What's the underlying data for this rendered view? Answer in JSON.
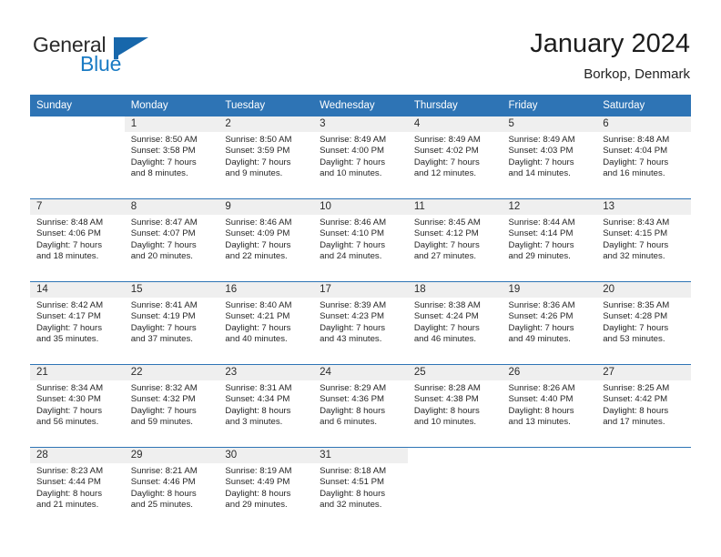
{
  "brand": {
    "name_part1": "General",
    "name_part2": "Blue",
    "flag_icon": "flag-triangle-icon",
    "accent_color": "#1767ab"
  },
  "header": {
    "title": "January 2024",
    "location": "Borkop, Denmark"
  },
  "theme": {
    "header_blue": "#2e74b5",
    "daynum_band": "#efefef",
    "text": "#262626"
  },
  "weekday_headers": [
    "Sunday",
    "Monday",
    "Tuesday",
    "Wednesday",
    "Thursday",
    "Friday",
    "Saturday"
  ],
  "weeks": [
    [
      {
        "day": "",
        "sunrise": "",
        "sunset": "",
        "daylight_line1": "",
        "daylight_line2": "",
        "blank": true
      },
      {
        "day": "1",
        "sunrise": "Sunrise: 8:50 AM",
        "sunset": "Sunset: 3:58 PM",
        "daylight_line1": "Daylight: 7 hours",
        "daylight_line2": "and 8 minutes."
      },
      {
        "day": "2",
        "sunrise": "Sunrise: 8:50 AM",
        "sunset": "Sunset: 3:59 PM",
        "daylight_line1": "Daylight: 7 hours",
        "daylight_line2": "and 9 minutes."
      },
      {
        "day": "3",
        "sunrise": "Sunrise: 8:49 AM",
        "sunset": "Sunset: 4:00 PM",
        "daylight_line1": "Daylight: 7 hours",
        "daylight_line2": "and 10 minutes."
      },
      {
        "day": "4",
        "sunrise": "Sunrise: 8:49 AM",
        "sunset": "Sunset: 4:02 PM",
        "daylight_line1": "Daylight: 7 hours",
        "daylight_line2": "and 12 minutes."
      },
      {
        "day": "5",
        "sunrise": "Sunrise: 8:49 AM",
        "sunset": "Sunset: 4:03 PM",
        "daylight_line1": "Daylight: 7 hours",
        "daylight_line2": "and 14 minutes."
      },
      {
        "day": "6",
        "sunrise": "Sunrise: 8:48 AM",
        "sunset": "Sunset: 4:04 PM",
        "daylight_line1": "Daylight: 7 hours",
        "daylight_line2": "and 16 minutes."
      }
    ],
    [
      {
        "day": "7",
        "sunrise": "Sunrise: 8:48 AM",
        "sunset": "Sunset: 4:06 PM",
        "daylight_line1": "Daylight: 7 hours",
        "daylight_line2": "and 18 minutes."
      },
      {
        "day": "8",
        "sunrise": "Sunrise: 8:47 AM",
        "sunset": "Sunset: 4:07 PM",
        "daylight_line1": "Daylight: 7 hours",
        "daylight_line2": "and 20 minutes."
      },
      {
        "day": "9",
        "sunrise": "Sunrise: 8:46 AM",
        "sunset": "Sunset: 4:09 PM",
        "daylight_line1": "Daylight: 7 hours",
        "daylight_line2": "and 22 minutes."
      },
      {
        "day": "10",
        "sunrise": "Sunrise: 8:46 AM",
        "sunset": "Sunset: 4:10 PM",
        "daylight_line1": "Daylight: 7 hours",
        "daylight_line2": "and 24 minutes."
      },
      {
        "day": "11",
        "sunrise": "Sunrise: 8:45 AM",
        "sunset": "Sunset: 4:12 PM",
        "daylight_line1": "Daylight: 7 hours",
        "daylight_line2": "and 27 minutes."
      },
      {
        "day": "12",
        "sunrise": "Sunrise: 8:44 AM",
        "sunset": "Sunset: 4:14 PM",
        "daylight_line1": "Daylight: 7 hours",
        "daylight_line2": "and 29 minutes."
      },
      {
        "day": "13",
        "sunrise": "Sunrise: 8:43 AM",
        "sunset": "Sunset: 4:15 PM",
        "daylight_line1": "Daylight: 7 hours",
        "daylight_line2": "and 32 minutes."
      }
    ],
    [
      {
        "day": "14",
        "sunrise": "Sunrise: 8:42 AM",
        "sunset": "Sunset: 4:17 PM",
        "daylight_line1": "Daylight: 7 hours",
        "daylight_line2": "and 35 minutes."
      },
      {
        "day": "15",
        "sunrise": "Sunrise: 8:41 AM",
        "sunset": "Sunset: 4:19 PM",
        "daylight_line1": "Daylight: 7 hours",
        "daylight_line2": "and 37 minutes."
      },
      {
        "day": "16",
        "sunrise": "Sunrise: 8:40 AM",
        "sunset": "Sunset: 4:21 PM",
        "daylight_line1": "Daylight: 7 hours",
        "daylight_line2": "and 40 minutes."
      },
      {
        "day": "17",
        "sunrise": "Sunrise: 8:39 AM",
        "sunset": "Sunset: 4:23 PM",
        "daylight_line1": "Daylight: 7 hours",
        "daylight_line2": "and 43 minutes."
      },
      {
        "day": "18",
        "sunrise": "Sunrise: 8:38 AM",
        "sunset": "Sunset: 4:24 PM",
        "daylight_line1": "Daylight: 7 hours",
        "daylight_line2": "and 46 minutes."
      },
      {
        "day": "19",
        "sunrise": "Sunrise: 8:36 AM",
        "sunset": "Sunset: 4:26 PM",
        "daylight_line1": "Daylight: 7 hours",
        "daylight_line2": "and 49 minutes."
      },
      {
        "day": "20",
        "sunrise": "Sunrise: 8:35 AM",
        "sunset": "Sunset: 4:28 PM",
        "daylight_line1": "Daylight: 7 hours",
        "daylight_line2": "and 53 minutes."
      }
    ],
    [
      {
        "day": "21",
        "sunrise": "Sunrise: 8:34 AM",
        "sunset": "Sunset: 4:30 PM",
        "daylight_line1": "Daylight: 7 hours",
        "daylight_line2": "and 56 minutes."
      },
      {
        "day": "22",
        "sunrise": "Sunrise: 8:32 AM",
        "sunset": "Sunset: 4:32 PM",
        "daylight_line1": "Daylight: 7 hours",
        "daylight_line2": "and 59 minutes."
      },
      {
        "day": "23",
        "sunrise": "Sunrise: 8:31 AM",
        "sunset": "Sunset: 4:34 PM",
        "daylight_line1": "Daylight: 8 hours",
        "daylight_line2": "and 3 minutes."
      },
      {
        "day": "24",
        "sunrise": "Sunrise: 8:29 AM",
        "sunset": "Sunset: 4:36 PM",
        "daylight_line1": "Daylight: 8 hours",
        "daylight_line2": "and 6 minutes."
      },
      {
        "day": "25",
        "sunrise": "Sunrise: 8:28 AM",
        "sunset": "Sunset: 4:38 PM",
        "daylight_line1": "Daylight: 8 hours",
        "daylight_line2": "and 10 minutes."
      },
      {
        "day": "26",
        "sunrise": "Sunrise: 8:26 AM",
        "sunset": "Sunset: 4:40 PM",
        "daylight_line1": "Daylight: 8 hours",
        "daylight_line2": "and 13 minutes."
      },
      {
        "day": "27",
        "sunrise": "Sunrise: 8:25 AM",
        "sunset": "Sunset: 4:42 PM",
        "daylight_line1": "Daylight: 8 hours",
        "daylight_line2": "and 17 minutes."
      }
    ],
    [
      {
        "day": "28",
        "sunrise": "Sunrise: 8:23 AM",
        "sunset": "Sunset: 4:44 PM",
        "daylight_line1": "Daylight: 8 hours",
        "daylight_line2": "and 21 minutes."
      },
      {
        "day": "29",
        "sunrise": "Sunrise: 8:21 AM",
        "sunset": "Sunset: 4:46 PM",
        "daylight_line1": "Daylight: 8 hours",
        "daylight_line2": "and 25 minutes."
      },
      {
        "day": "30",
        "sunrise": "Sunrise: 8:19 AM",
        "sunset": "Sunset: 4:49 PM",
        "daylight_line1": "Daylight: 8 hours",
        "daylight_line2": "and 29 minutes."
      },
      {
        "day": "31",
        "sunrise": "Sunrise: 8:18 AM",
        "sunset": "Sunset: 4:51 PM",
        "daylight_line1": "Daylight: 8 hours",
        "daylight_line2": "and 32 minutes."
      },
      {
        "day": "",
        "sunrise": "",
        "sunset": "",
        "daylight_line1": "",
        "daylight_line2": "",
        "blank": true
      },
      {
        "day": "",
        "sunrise": "",
        "sunset": "",
        "daylight_line1": "",
        "daylight_line2": "",
        "blank": true
      },
      {
        "day": "",
        "sunrise": "",
        "sunset": "",
        "daylight_line1": "",
        "daylight_line2": "",
        "blank": true
      }
    ]
  ]
}
